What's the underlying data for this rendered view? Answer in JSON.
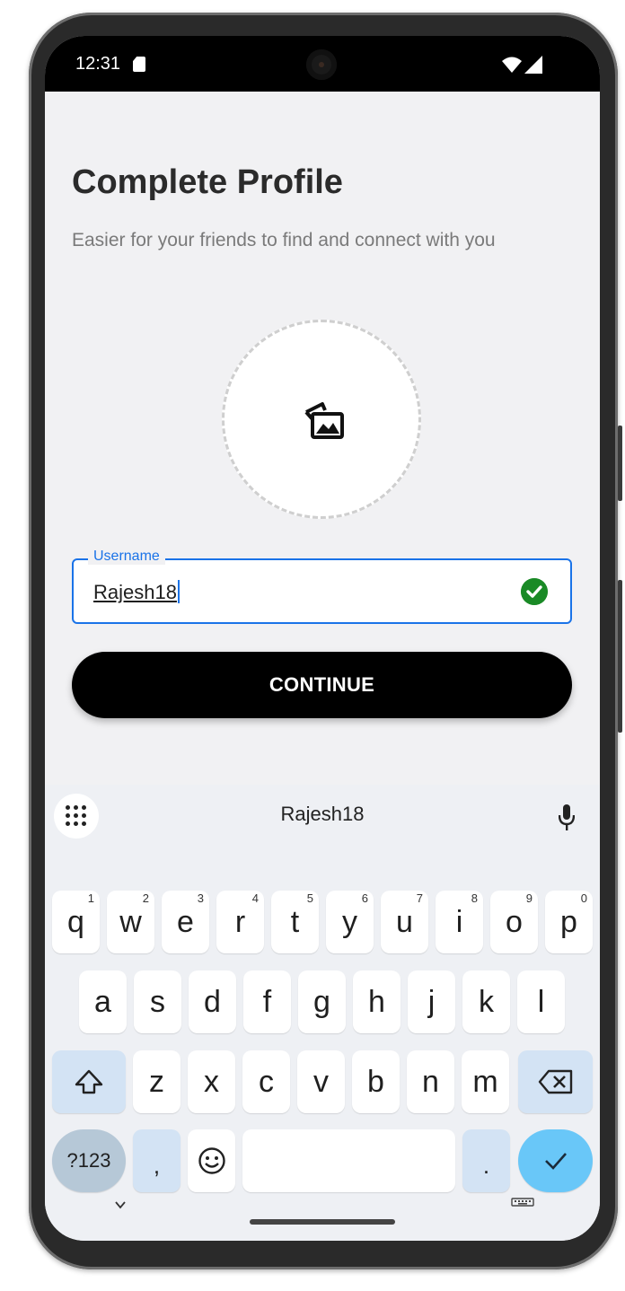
{
  "status": {
    "time": "12:31"
  },
  "header": {
    "title": "Complete Profile",
    "subtitle": "Easier for your friends to find and connect with you"
  },
  "form": {
    "username_label": "Username",
    "username_value": "Rajesh18",
    "username_valid": true,
    "continue_label": "CONTINUE"
  },
  "keyboard": {
    "suggestion": "Rajesh18",
    "row1": [
      {
        "key": "q",
        "hint": "1"
      },
      {
        "key": "w",
        "hint": "2"
      },
      {
        "key": "e",
        "hint": "3"
      },
      {
        "key": "r",
        "hint": "4"
      },
      {
        "key": "t",
        "hint": "5"
      },
      {
        "key": "y",
        "hint": "6"
      },
      {
        "key": "u",
        "hint": "7"
      },
      {
        "key": "i",
        "hint": "8"
      },
      {
        "key": "o",
        "hint": "9"
      },
      {
        "key": "p",
        "hint": "0"
      }
    ],
    "row2": [
      "a",
      "s",
      "d",
      "f",
      "g",
      "h",
      "j",
      "k",
      "l"
    ],
    "row3": [
      "z",
      "x",
      "c",
      "v",
      "b",
      "n",
      "m"
    ],
    "symbols_label": "?123",
    "comma_label": ",",
    "period_label": ".",
    "colors": {
      "modifier": "#d3e3f4",
      "enter": "#69c7f8",
      "symbols": "#b6c8d7"
    }
  },
  "colors": {
    "accent": "#1a73e8",
    "valid": "#1a8a26",
    "button": "#000000"
  }
}
